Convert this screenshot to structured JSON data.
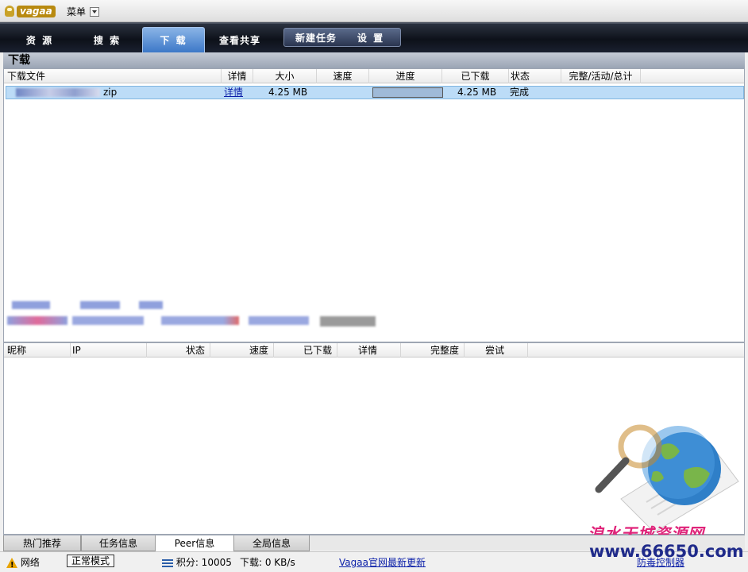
{
  "titlebar": {
    "logo_text": "vagaa",
    "menu_label": "菜单"
  },
  "nav": {
    "tabs": [
      {
        "label": "资 源"
      },
      {
        "label": "搜 索"
      },
      {
        "label": "下 载"
      },
      {
        "label": "查看共享"
      }
    ],
    "actions": [
      {
        "label": "新建任务"
      },
      {
        "label": "设 置"
      }
    ]
  },
  "section_title": "下载",
  "download_table": {
    "headers": [
      "下载文件",
      "详情",
      "大小",
      "速度",
      "进度",
      "已下载",
      "状态",
      "完整/活动/总计"
    ],
    "rows": [
      {
        "file": "zip",
        "details": "详情",
        "size": "4.25 MB",
        "speed": "",
        "progress": 1.0,
        "downloaded": "4.25 MB",
        "status": "完成",
        "complete_active_total": ""
      }
    ]
  },
  "peer_table": {
    "headers": [
      "昵称",
      "IP",
      "状态",
      "速度",
      "已下载",
      "详情",
      "完整度",
      "尝试"
    ]
  },
  "bottom_tabs": [
    {
      "label": "热门推荐"
    },
    {
      "label": "任务信息"
    },
    {
      "label": "Peer信息"
    },
    {
      "label": "全局信息"
    }
  ],
  "status": {
    "network_label": "网络",
    "mode_label": "正常模式",
    "points_text": "积分: 10005",
    "download_rate": "下载: 0 KB/s",
    "update_link": "Vagaa官网最新更新",
    "right_link": "防毒控制器"
  },
  "watermark": {
    "line1": "浪水天城资源网",
    "line2": "www.66650.com"
  },
  "colors": {
    "nav_bg": "#0d1119",
    "active_tab": "#3c78c8",
    "row_selected": "#bcdcf7",
    "progress_fill": "#9fbad8"
  }
}
